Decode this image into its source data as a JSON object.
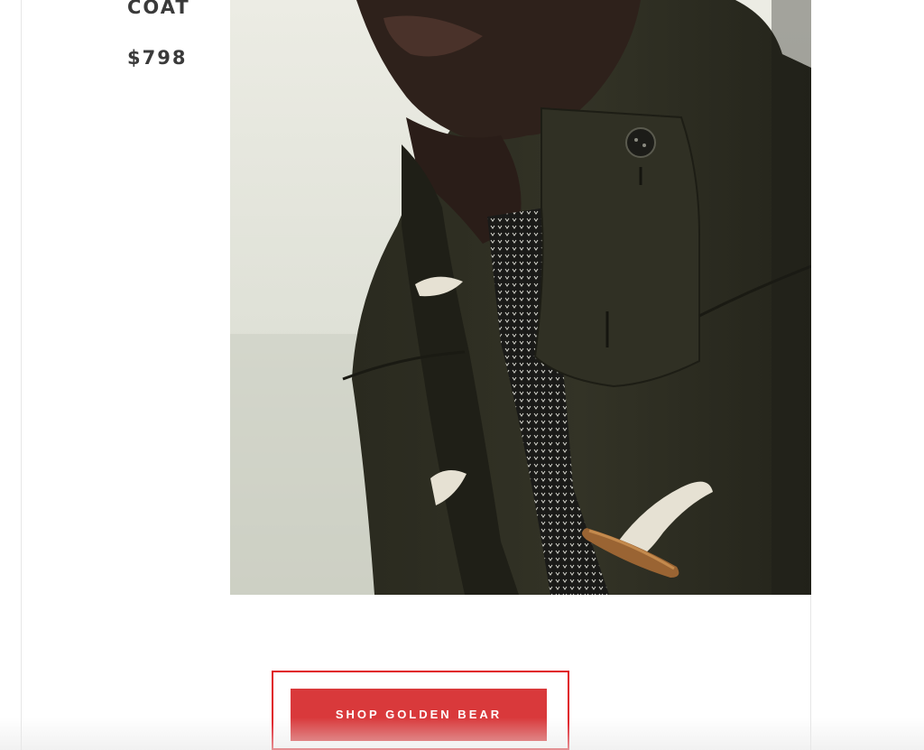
{
  "product": {
    "name": "COAT",
    "price": "$798"
  },
  "photo": {
    "subject": "model-in-duffle-coat-photo"
  },
  "cta": {
    "label": "SHOP GOLDEN BEAR"
  },
  "colors": {
    "button": "#d9393b",
    "highlight": "#e0141e",
    "text": "#3a3a3a"
  }
}
